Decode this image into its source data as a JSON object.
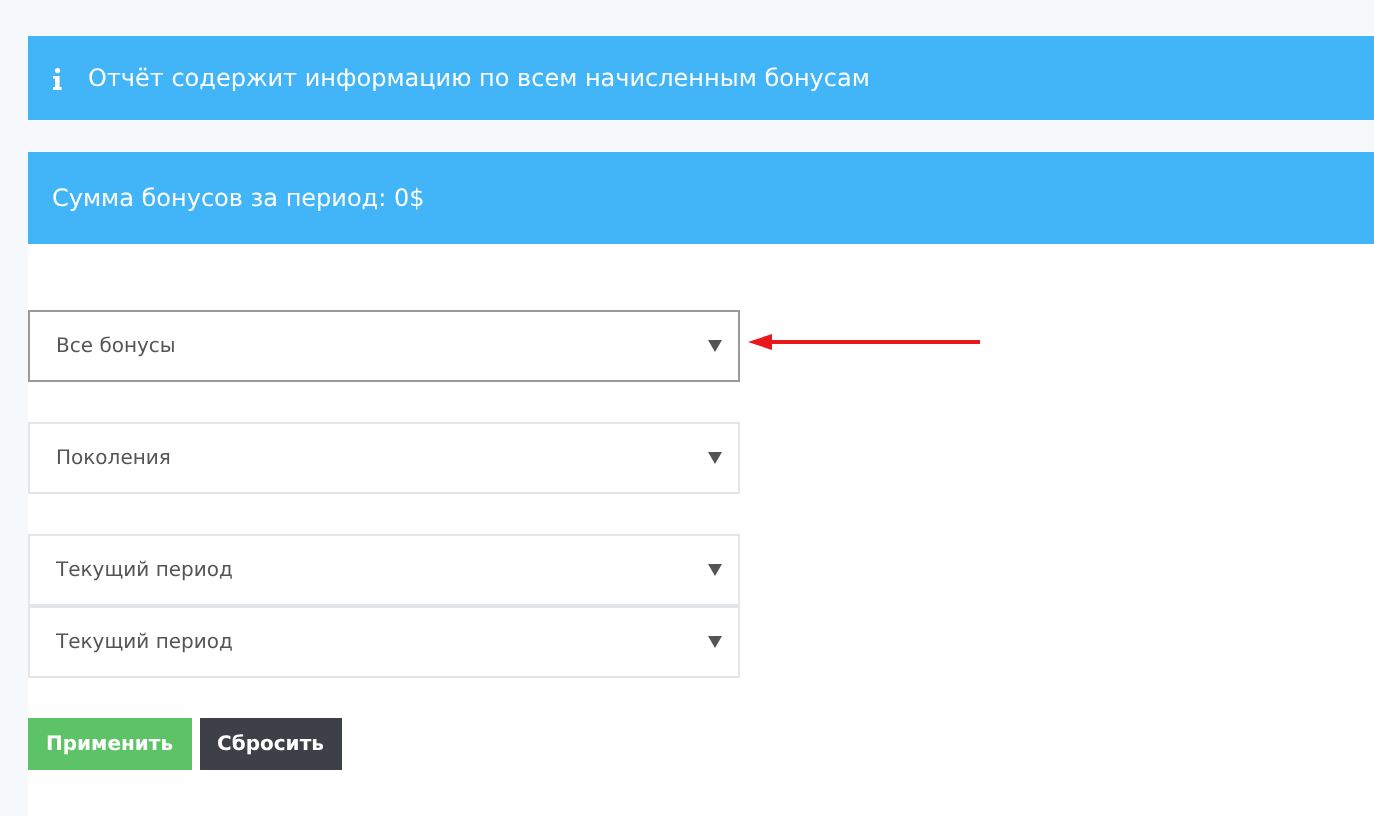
{
  "notices": [
    {
      "kind": "info",
      "text": "Отчёт содержит информацию по всем начисленным бонусам"
    },
    {
      "kind": "plain",
      "text": "Сумма бонусов за период: 0$"
    }
  ],
  "filters": [
    {
      "value": "Все бонусы",
      "focused": true
    },
    {
      "value": "Поколения",
      "focused": false
    },
    {
      "value": "Текущий период",
      "focused": false
    },
    {
      "value": "Текущий период",
      "focused": false
    }
  ],
  "buttons": [
    {
      "kind": "primary",
      "label": "Применить"
    },
    {
      "kind": "secondary",
      "label": "Сбросить"
    }
  ]
}
